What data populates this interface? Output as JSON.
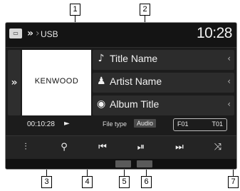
{
  "callouts": [
    "1",
    "2",
    "3",
    "4",
    "5",
    "6",
    "7"
  ],
  "header": {
    "source_label": "USB",
    "clock": "10:28",
    "source_icon": "usb-source-icon"
  },
  "side_tab": {
    "chevron": "»"
  },
  "artwork": {
    "logo_text": "KENWOOD"
  },
  "info": [
    {
      "icon": "♪",
      "icon_name": "music-note-icon",
      "label": "Title Name",
      "caret": "‹"
    },
    {
      "icon": "♟",
      "icon_name": "artist-icon",
      "label": "Artist Name",
      "caret": "‹"
    },
    {
      "icon": "◉",
      "icon_name": "album-icon",
      "label": "Album Title",
      "caret": "‹"
    }
  ],
  "status": {
    "time": "00:10:28",
    "play_indicator": "►",
    "file_type_label": "File type",
    "file_type_value": "Audio",
    "folder": "F01",
    "track": "T01"
  },
  "controls": [
    {
      "name": "equalizer-button",
      "glyph": "⫶"
    },
    {
      "name": "search-button",
      "glyph": "⚲"
    },
    {
      "name": "previous-track-button",
      "glyph": "⏮"
    },
    {
      "name": "play-pause-button",
      "glyph": "⏯"
    },
    {
      "name": "next-track-button",
      "glyph": "⏭"
    },
    {
      "name": "shuffle-button",
      "glyph": "⤨"
    }
  ]
}
